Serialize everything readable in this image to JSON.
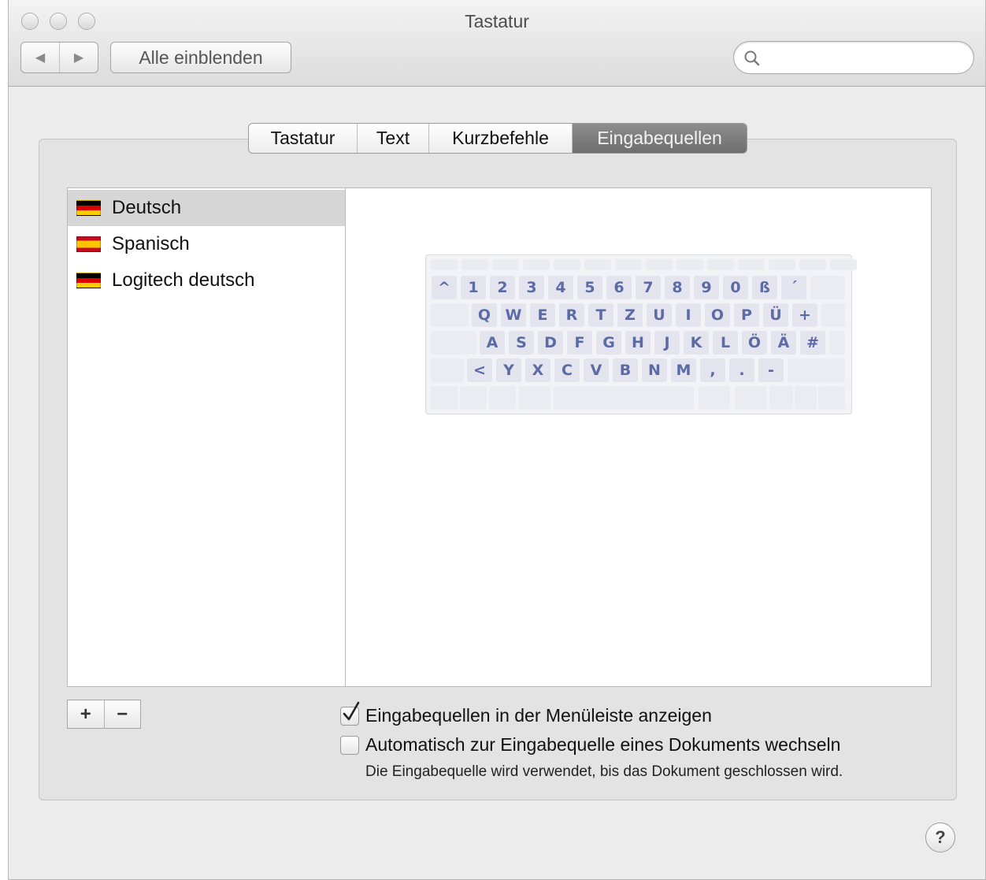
{
  "window": {
    "title": "Tastatur",
    "nav": {
      "back_glyph": "◀",
      "forward_glyph": "▶"
    },
    "show_all_label": "Alle einblenden",
    "search": {
      "placeholder": "",
      "value": ""
    }
  },
  "tabs": [
    {
      "label": "Tastatur",
      "active": false
    },
    {
      "label": "Text",
      "active": false
    },
    {
      "label": "Kurzbefehle",
      "active": false
    },
    {
      "label": "Eingabequellen",
      "active": true
    }
  ],
  "input_sources": [
    {
      "label": "Deutsch",
      "flag": "germany",
      "selected": true
    },
    {
      "label": "Spanisch",
      "flag": "spain",
      "selected": false
    },
    {
      "label": "Logitech deutsch",
      "flag": "germany",
      "selected": false
    }
  ],
  "keyboard_preview": {
    "rows": [
      [
        "^",
        "1",
        "2",
        "3",
        "4",
        "5",
        "6",
        "7",
        "8",
        "9",
        "0",
        "ß",
        "´"
      ],
      [
        "Q",
        "W",
        "E",
        "R",
        "T",
        "Z",
        "U",
        "I",
        "O",
        "P",
        "Ü",
        "+"
      ],
      [
        "A",
        "S",
        "D",
        "F",
        "G",
        "H",
        "J",
        "K",
        "L",
        "Ö",
        "Ä",
        "#"
      ],
      [
        "<",
        "Y",
        "X",
        "C",
        "V",
        "B",
        "N",
        "M",
        ",",
        ".",
        "-"
      ]
    ]
  },
  "list_buttons": {
    "add": "+",
    "remove": "−"
  },
  "options": {
    "show_in_menubar": {
      "label": "Eingabequellen in der Menüleiste anzeigen",
      "checked": true
    },
    "auto_switch": {
      "label": "Automatisch zur Eingabequelle eines Dokuments wechseln",
      "checked": false
    },
    "auto_switch_note": "Die Eingabequelle wird verwendet, bis das Dokument geschlossen wird."
  },
  "help_label": "?",
  "colors": {
    "key_text": "#5c6aa6",
    "active_tab": "#7c7c7c",
    "selected_row": "#d6d6d6"
  }
}
